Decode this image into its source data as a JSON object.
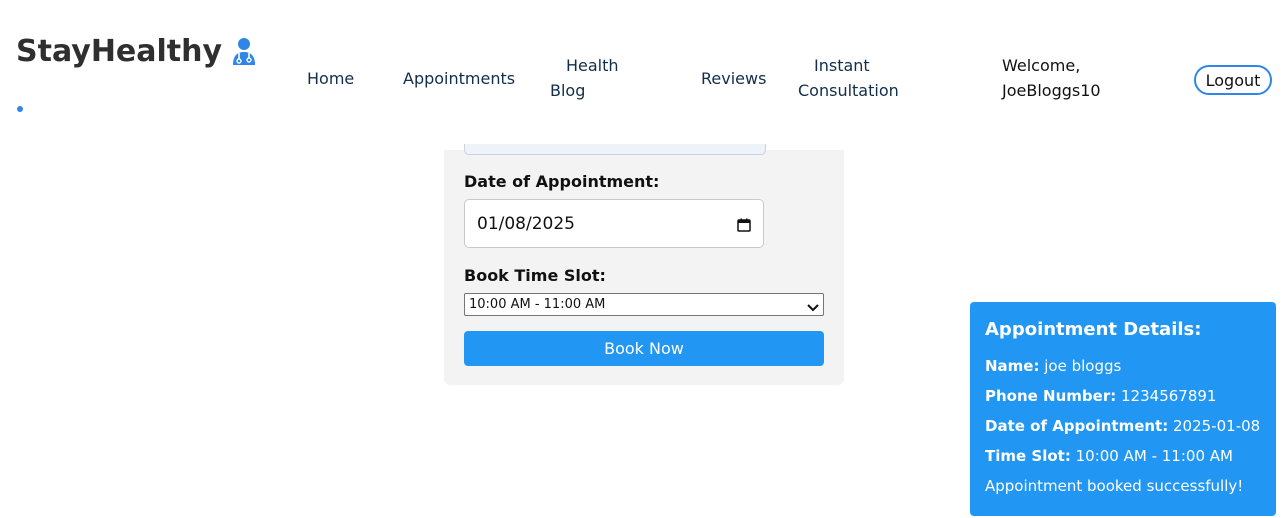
{
  "header": {
    "brand": "StayHealthy",
    "nav": {
      "home": "Home",
      "appointments": "Appointments",
      "health_blog_line1": "Health",
      "health_blog_line2": "Blog",
      "reviews": "Reviews",
      "consultation_line1": "Instant",
      "consultation_line2": "Consultation"
    },
    "welcome_line1": "Welcome,",
    "welcome_line2": "JoeBloggs10",
    "logout_label": "Logout",
    "brand_icon": "doctor-icon"
  },
  "form": {
    "date_label": "Date of Appointment:",
    "date_value": "01/08/2025",
    "slot_label": "Book Time Slot:",
    "slot_value": "10:00 AM - 11:00 AM",
    "book_label": "Book Now"
  },
  "details": {
    "title": "Appointment Details:",
    "name_key": "Name:",
    "name_value": "joe bloggs",
    "phone_key": "Phone Number:",
    "phone_value": "1234567891",
    "date_key": "Date of Appointment:",
    "date_value": "2025-01-08",
    "slot_key": "Time Slot:",
    "slot_value": "10:00 AM - 11:00 AM",
    "status": "Appointment booked successfully!"
  },
  "colors": {
    "accent": "#2196f3",
    "brand_blue": "#2f86e8",
    "card_bg": "#f3f3f3",
    "nav_text": "#122e4a"
  }
}
